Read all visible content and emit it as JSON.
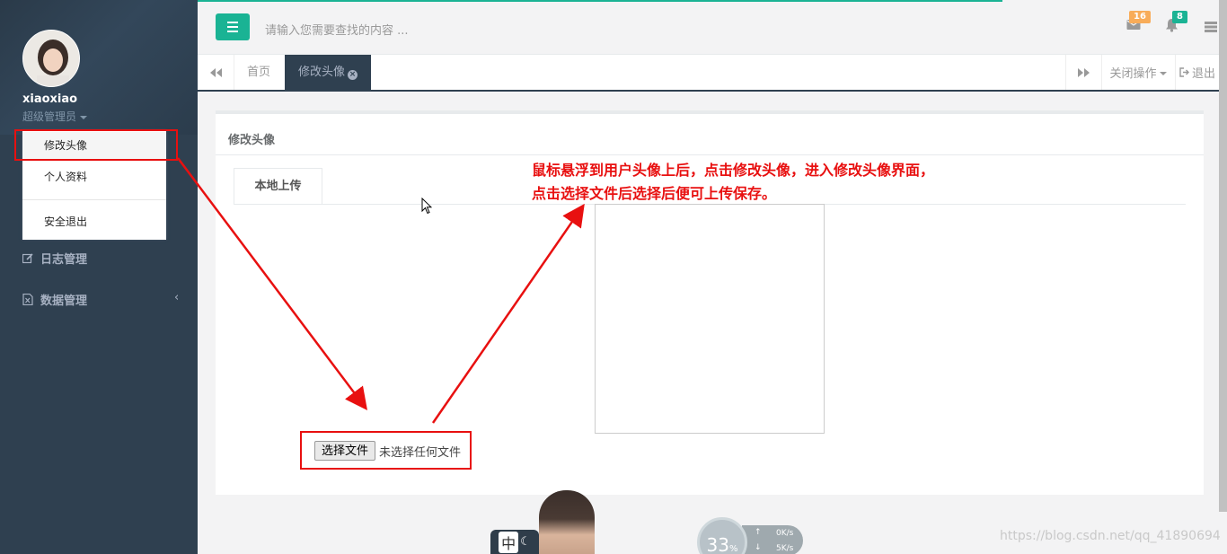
{
  "sidebar": {
    "username": "xiaoxiao",
    "role": "超级管理员",
    "dropdown": [
      "修改头像",
      "个人资料",
      "安全退出"
    ],
    "nav": [
      {
        "label": "日志管理",
        "icon": "edit-icon"
      },
      {
        "label": "数据管理",
        "icon": "file-excel-icon"
      }
    ],
    "nav_arrow": "‹"
  },
  "topbar": {
    "search_placeholder": "请输入您需要查找的内容 ...",
    "mail_badge": "16",
    "bell_badge": "8",
    "colors": {
      "accent": "#1ab394",
      "mail_badge": "#f8ac59",
      "bell_badge": "#1ab394"
    }
  },
  "tabs": {
    "home": "首页",
    "active": "修改头像",
    "close_ops": "关闭操作",
    "logout": "退出"
  },
  "main": {
    "title": "修改头像",
    "upload_tab": "本地上传",
    "file_button": "选择文件",
    "file_status": "未选择任何文件"
  },
  "annotation": {
    "line1": "鼠标悬浮到用户头像上后，点击修改头像，进入修改头像界面，",
    "line2": "点击选择文件后选择后便可上传保存。"
  },
  "widgets": {
    "ime": "中",
    "gauge": "33",
    "gauge_unit": "%",
    "net_up": "0",
    "net_unit": "K/s",
    "net_down": "5"
  },
  "watermark": "https://blog.csdn.net/qq_41890694"
}
